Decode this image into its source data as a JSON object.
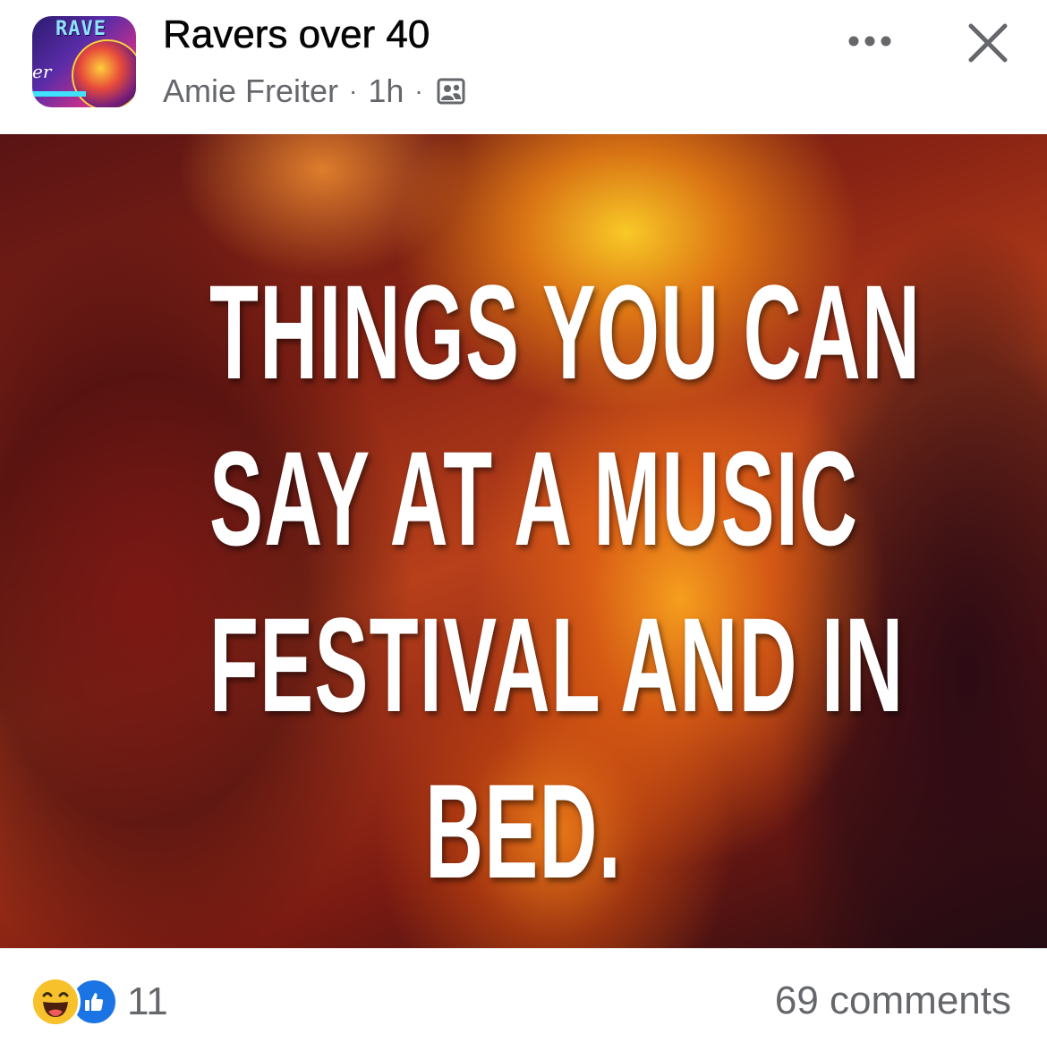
{
  "post": {
    "group_name": "Ravers over 40",
    "author": "Amie Freiter",
    "time": "1h",
    "separator": "·",
    "privacy_icon": "group-members-icon",
    "more_icon": "more-horizontal-icon",
    "close_icon": "close-icon",
    "image_text_lines": [
      "THINGS YOU CAN",
      "SAY AT A MUSIC",
      "FESTIVAL AND IN",
      "BED."
    ],
    "avatar_text": "RAVE"
  },
  "footer": {
    "reaction_icons": [
      "haha-reaction-icon",
      "like-reaction-icon"
    ],
    "reaction_count": "11",
    "comments": "69 comments"
  },
  "colors": {
    "text_primary": "#050505",
    "text_secondary": "#65676b",
    "like_blue": "#1b74e4",
    "haha_yellow": "#f7c12c"
  }
}
